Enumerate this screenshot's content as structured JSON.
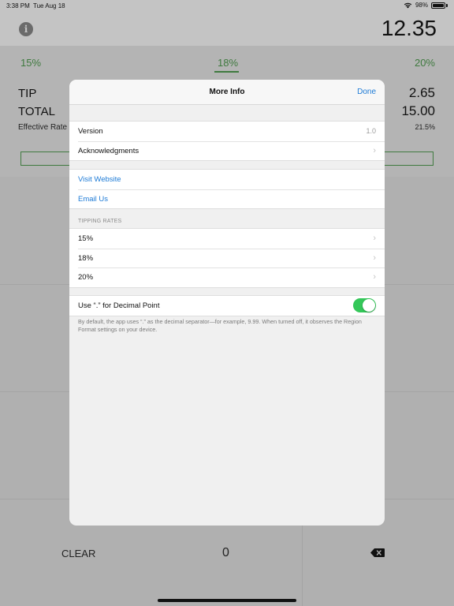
{
  "status_bar": {
    "time": "3:38 PM",
    "date": "Tue Aug 18",
    "battery": "98%",
    "battery_level": 0.98
  },
  "app": {
    "bill_amount": "12.35",
    "rates": [
      "15%",
      "18%",
      "20%"
    ],
    "selected_rate": "18%",
    "tip_label": "TIP",
    "tip_value": "2.65",
    "total_label": "TOTAL",
    "total_value": "15.00",
    "effective_rate_label": "Effective Rate",
    "effective_rate_value": "21.5%",
    "keypad": {
      "clear": "CLEAR",
      "zero": "0"
    },
    "accent_color": "#3f7a3f"
  },
  "modal": {
    "title": "More Info",
    "done_label": "Done",
    "version_label": "Version",
    "version_value": "1.0",
    "acknowledgments_label": "Acknowledgments",
    "visit_website_label": "Visit Website",
    "email_us_label": "Email Us",
    "tipping_rates_header": "TIPPING RATES",
    "tipping_rates": [
      "15%",
      "18%",
      "20%"
    ],
    "decimal_toggle_label": "Use “.” for Decimal Point",
    "decimal_toggle_on": true,
    "decimal_footnote": "By default, the app uses “.” as the decimal separator—for example, 9.99. When turned off, it observes the Region Format settings on your device.",
    "link_color": "#1e7bd6",
    "toggle_color": "#34c759"
  }
}
